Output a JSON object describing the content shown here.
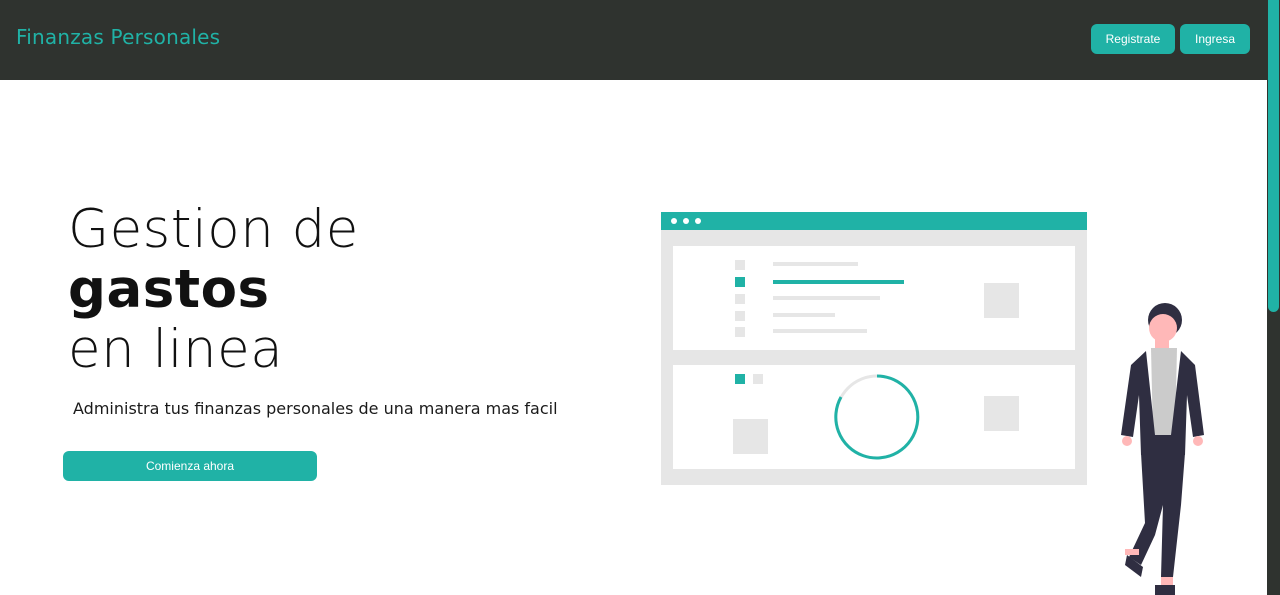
{
  "header": {
    "brand": "Finanzas Personales",
    "register_label": "Registrate",
    "login_label": "Ingresa"
  },
  "hero": {
    "line1": "Gestion de",
    "line2": "gastos",
    "line3": "en linea",
    "subtitle": "Administra tus finanzas personales de una manera mas facil",
    "cta_label": "Comienza ahora"
  },
  "colors": {
    "accent": "#20b2a6",
    "navbar": "#2f332f",
    "illustration_gray": "#e6e6e6"
  },
  "illustration": {
    "icon": "dashboard-person-illustration"
  }
}
